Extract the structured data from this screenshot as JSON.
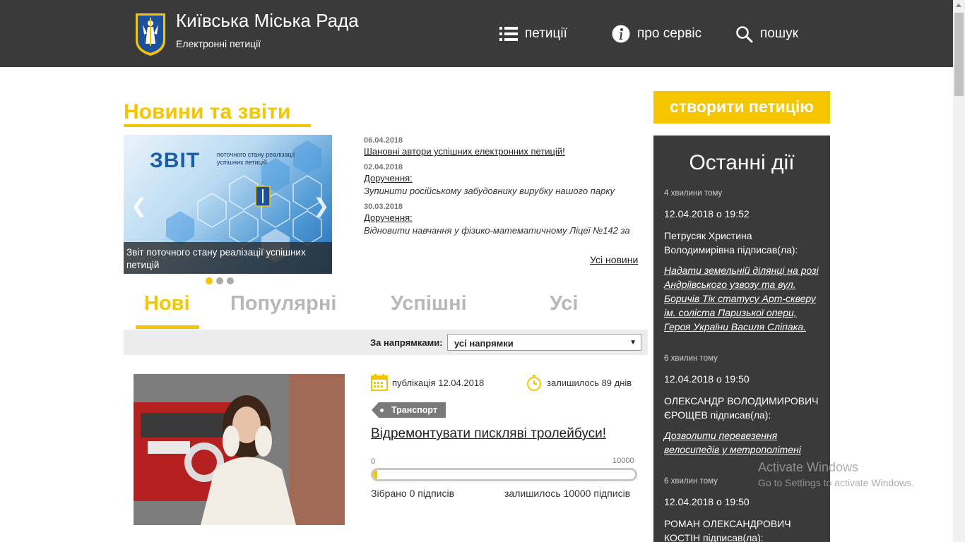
{
  "header": {
    "title": "Київська Міська Рада",
    "subtitle": "Електронні петиції",
    "nav": [
      {
        "label": "петиції",
        "icon": "list-icon"
      },
      {
        "label": "про сервіс",
        "icon": "info-icon"
      },
      {
        "label": "пошук",
        "icon": "search-icon"
      }
    ]
  },
  "news": {
    "heading": "Новини та звіти",
    "slide": {
      "title": "ЗВІТ",
      "subtitle": "поточного стану реалізації успішних петицій",
      "caption": "Звіт поточного стану реалізації успішних петицій",
      "dots": 3,
      "active_dot": 1
    },
    "items": [
      {
        "date": "06.04.2018",
        "link": "Шановні автори успішних електронних петицій!",
        "desc": ""
      },
      {
        "date": "02.04.2018",
        "link": "Доручення:",
        "desc": "Зупинити російському забудовнику вирубку нашого парку"
      },
      {
        "date": "30.03.2018",
        "link": "Доручення:",
        "desc": "Відновити навчання у фізико-математичному Ліцеї №142 за"
      }
    ],
    "all_news": "Усі новини"
  },
  "tabs": [
    {
      "label": "Нові",
      "active": true
    },
    {
      "label": "Популярні",
      "active": false
    },
    {
      "label": "Успішні",
      "active": false
    },
    {
      "label": "Усі",
      "active": false
    }
  ],
  "filter": {
    "label": "За напрямками:",
    "selected": "усі напрямки"
  },
  "petition": {
    "published": "публікація 12.04.2018",
    "days_left": "залишилось 89 днів",
    "tag": "Транспорт",
    "title": "Відремонтувати пискляві тролейбуси!",
    "progress_min": "0",
    "progress_max": "10000",
    "progress_fraction": 0.0,
    "collected": "Зібрано 0 підписів",
    "remaining": "залишилось 10000 підписів"
  },
  "sidebar": {
    "create_button": "створити петицію",
    "activity_title": "Останні дії",
    "entries": [
      {
        "ago": "4 хвилини тому",
        "time": "12.04.2018 о 19:52",
        "who": "Петрусяк Христина Володимирівна підписав(ла):",
        "link": "Надати земельній ділянці на розі Андріївського узвозу та вул. Боричів Тік статусу Арт-скверу ім. соліста Паризької опери, Героя України Василя Сліпака."
      },
      {
        "ago": "6 хвилин тому",
        "time": "12.04.2018 о 19:50",
        "who": "ОЛЕКСАНДР ВОЛОДИМИРОВИЧ ЄРОЩЕВ підписав(ла):",
        "link": "Дозволити перевезення велосипедів у метрополітені"
      },
      {
        "ago": "6 хвилин тому",
        "time": "12.04.2018 о 19:50",
        "who": "РОМАН ОЛЕКСАНДРОВИЧ КОСТІН підписав(ла):",
        "link": ""
      }
    ]
  },
  "watermark": {
    "line1": "Activate Windows",
    "line2": "Go to Settings to activate Windows."
  },
  "colors": {
    "accent": "#f5c600",
    "header_bg": "#3a3a3a",
    "sidebar_bg": "#3a3a3a"
  }
}
